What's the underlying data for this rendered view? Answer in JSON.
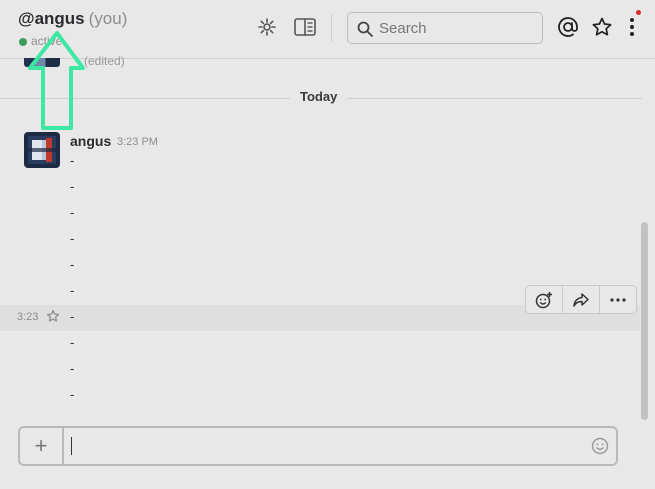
{
  "header": {
    "channel_name": "@angus",
    "you_tag": "(you)",
    "status_text": "active",
    "search_placeholder": "Search",
    "icons": [
      "gear-icon",
      "sidebar-panel-icon",
      "search-icon",
      "at-mention-icon",
      "star-icon",
      "more-vertical-icon"
    ]
  },
  "messages": {
    "previous_edited": "(edited)",
    "day_divider": "Today",
    "author": "angus",
    "timestamp": "3:23 PM",
    "lines": [
      "-",
      "-",
      "-",
      "-",
      "-",
      "-",
      "-",
      "-",
      "-",
      "-"
    ],
    "hover_time": "3:23"
  },
  "message_actions": [
    "add-reaction-icon",
    "share-icon",
    "more-horizontal-icon"
  ],
  "composer": {
    "plus_label": "+",
    "value": ""
  },
  "colors": {
    "background": "#e8e8e8",
    "presence": "#3c9a5f",
    "annotation_arrow": "#3ee8a4",
    "notification": "#d62b2b"
  }
}
